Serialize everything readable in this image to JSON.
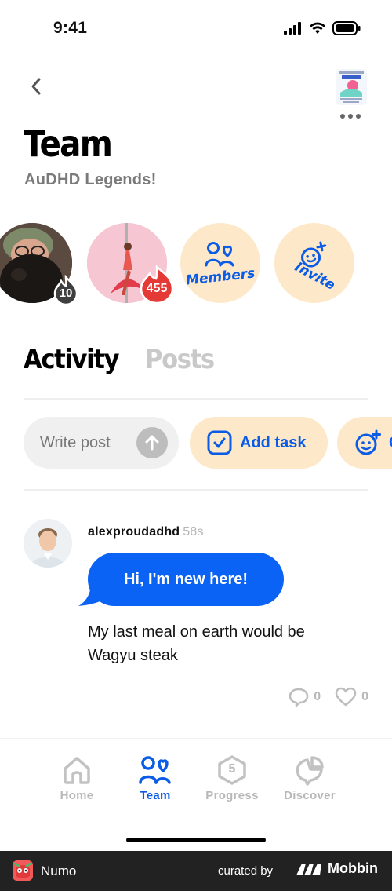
{
  "status_bar": {
    "time": "9:41"
  },
  "header": {
    "title": "Team",
    "subtitle": "AuDHD Legends!"
  },
  "members": {
    "items": [
      {
        "badge": "10",
        "badge_color": "#3f3f3f"
      },
      {
        "badge": "455",
        "badge_color": "#e53935"
      }
    ],
    "members_label": "Members",
    "invite_label": "Invite"
  },
  "tabs": [
    {
      "label": "Activity",
      "active": true
    },
    {
      "label": "Posts",
      "active": false
    }
  ],
  "actions": {
    "write_post_placeholder": "Write post",
    "add_task_label": "Add task",
    "next_label": "C"
  },
  "post": {
    "author": "alexproudadhd",
    "time": "58s",
    "bubble": "Hi, I'm new here!",
    "body": "My last meal on earth would be Wagyu steak",
    "comments": "0",
    "likes": "0"
  },
  "nav": [
    {
      "label": "Home",
      "icon": "home-icon",
      "active": false
    },
    {
      "label": "Team",
      "icon": "team-icon",
      "active": true
    },
    {
      "label": "Progress",
      "icon": "progress-icon",
      "active": false,
      "number": "5"
    },
    {
      "label": "Discover",
      "icon": "discover-icon",
      "active": false
    }
  ],
  "footer": {
    "app_name": "Numo",
    "curated_by": "curated by",
    "brand": "Mobbin"
  },
  "colors": {
    "accent": "#0a5be6",
    "cream": "#fde9c9",
    "badge_red": "#e53935"
  }
}
